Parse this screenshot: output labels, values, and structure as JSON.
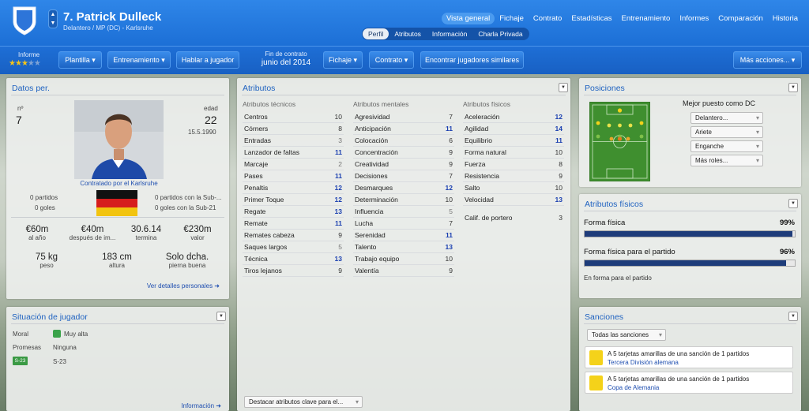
{
  "header": {
    "player_name": "7. Patrick Dulleck",
    "player_sub": "Delantero / MP (DC) - Karlsruhe",
    "nav": [
      "Vista general",
      "Fichaje",
      "Contrato",
      "Estadísticas",
      "Entrenamiento",
      "Informes",
      "Comparación",
      "Historia"
    ],
    "subtabs": [
      "Perfil",
      "Atributos",
      "Información",
      "Charla Privada"
    ],
    "up": "▲",
    "down": "▼"
  },
  "toolbar": {
    "informe_label": "Informe",
    "stars_rating": 3,
    "stars_total": 5,
    "plantilla": "Plantilla ▾",
    "entrenamiento": "Entrenamiento ▾",
    "hablar": "Hablar a jugador",
    "contract_label": "Fin de contrato",
    "contract_value": "junio del 2014",
    "fichaje": "Fichaje ▾",
    "contrato": "Contrato ▾",
    "similares": "Encontrar jugadores similares",
    "mas": "Más acciones... ▾"
  },
  "datos": {
    "title": "Datos per.",
    "num_label": "nº",
    "num": "7",
    "edad_label": "edad",
    "edad": "22",
    "birth": "15.5.1990",
    "contract_caption": "Contratado por el Karlsruhe",
    "partidos": "0 partidos",
    "goles": "0 goles",
    "partidos_sub": "0 partidos con la Sub-...",
    "goles_sub": "0 goles con la Sub-21",
    "stats": [
      {
        "v": "€60m",
        "l": "al año"
      },
      {
        "v": "€40m",
        "l": "después de im..."
      },
      {
        "v": "30.6.14",
        "l": "termina"
      },
      {
        "v": "€230m",
        "l": "valor"
      }
    ],
    "phys": [
      {
        "v": "75 kg",
        "l": "peso"
      },
      {
        "v": "183 cm",
        "l": "altura"
      },
      {
        "v": "Solo dcha.",
        "l": "pierna buena"
      }
    ],
    "link": "Ver detalles personales ➜"
  },
  "situacion": {
    "title": "Situación de jugador",
    "moral_l": "Moral",
    "moral_v": "Muy alta",
    "promesas_l": "Promesas",
    "promesas_v": "Ninguna",
    "badge": "S-23",
    "badge_v": "S-23",
    "link": "Información ➜"
  },
  "atributos": {
    "title": "Atributos",
    "tecnicos": {
      "h": "Atributos técnicos",
      "rows": [
        [
          "Centros",
          "10",
          ""
        ],
        [
          "Córners",
          "8",
          ""
        ],
        [
          "Entradas",
          "3",
          "g"
        ],
        [
          "Lanzador de faltas",
          "11",
          "b"
        ],
        [
          "Marcaje",
          "2",
          "g"
        ],
        [
          "Pases",
          "11",
          "b"
        ],
        [
          "Penaltis",
          "12",
          "b"
        ],
        [
          "Primer Toque",
          "12",
          "b"
        ],
        [
          "Regate",
          "13",
          "b"
        ],
        [
          "Remate",
          "11",
          "b"
        ],
        [
          "Remates cabeza",
          "9",
          ""
        ],
        [
          "Saques largos",
          "5",
          "g"
        ],
        [
          "Técnica",
          "13",
          "b"
        ],
        [
          "Tiros lejanos",
          "9",
          ""
        ]
      ]
    },
    "mentales": {
      "h": "Atributos mentales",
      "rows": [
        [
          "Agresividad",
          "7",
          ""
        ],
        [
          "Anticipación",
          "11",
          "b"
        ],
        [
          "Colocación",
          "6",
          ""
        ],
        [
          "Concentración",
          "9",
          ""
        ],
        [
          "Creatividad",
          "9",
          ""
        ],
        [
          "Decisiones",
          "7",
          ""
        ],
        [
          "Desmarques",
          "12",
          "b"
        ],
        [
          "Determinación",
          "10",
          ""
        ],
        [
          "Influencia",
          "5",
          "g"
        ],
        [
          "Lucha",
          "7",
          ""
        ],
        [
          "Serenidad",
          "11",
          "b"
        ],
        [
          "Talento",
          "13",
          "b"
        ],
        [
          "Trabajo equipo",
          "10",
          ""
        ],
        [
          "Valentía",
          "9",
          ""
        ]
      ]
    },
    "fisicos": {
      "h": "Atributos físicos",
      "rows": [
        [
          "Aceleración",
          "12",
          "b"
        ],
        [
          "Agilidad",
          "14",
          "b"
        ],
        [
          "Equilibrio",
          "11",
          "b"
        ],
        [
          "Forma natural",
          "10",
          ""
        ],
        [
          "Fuerza",
          "8",
          ""
        ],
        [
          "Resistencia",
          "9",
          ""
        ],
        [
          "Salto",
          "10",
          ""
        ],
        [
          "Velocidad",
          "13",
          "b"
        ]
      ]
    },
    "portero": [
      "Calif. de portero",
      "3"
    ],
    "destacar": "Destacar atributos clave para el..."
  },
  "posiciones": {
    "title": "Posiciones",
    "mejor": "Mejor puesto como DC",
    "roles": [
      "Delantero...",
      "Ariete",
      "Enganche",
      "Más roles..."
    ]
  },
  "fisicos": {
    "title": "Atributos físicos",
    "forma_l": "Forma física",
    "forma_v": "99%",
    "forma_p": 99,
    "partido_l": "Forma física para el partido",
    "partido_v": "96%",
    "partido_p": 96,
    "note": "En forma para el partido"
  },
  "sanciones": {
    "title": "Sanciones",
    "filter": "Todas las sanciones",
    "items": [
      {
        "t": "A 5 tarjetas amarillas de una sanción de 1 partidos",
        "c": "Tercera División alemana"
      },
      {
        "t": "A 5 tarjetas amarillas de una sanción de 1 partidos",
        "c": "Copa de Alemania"
      }
    ]
  },
  "colors": {
    "accent": "#1f62c0",
    "header": "#2f86e8",
    "bar": "#1e3c7a"
  }
}
